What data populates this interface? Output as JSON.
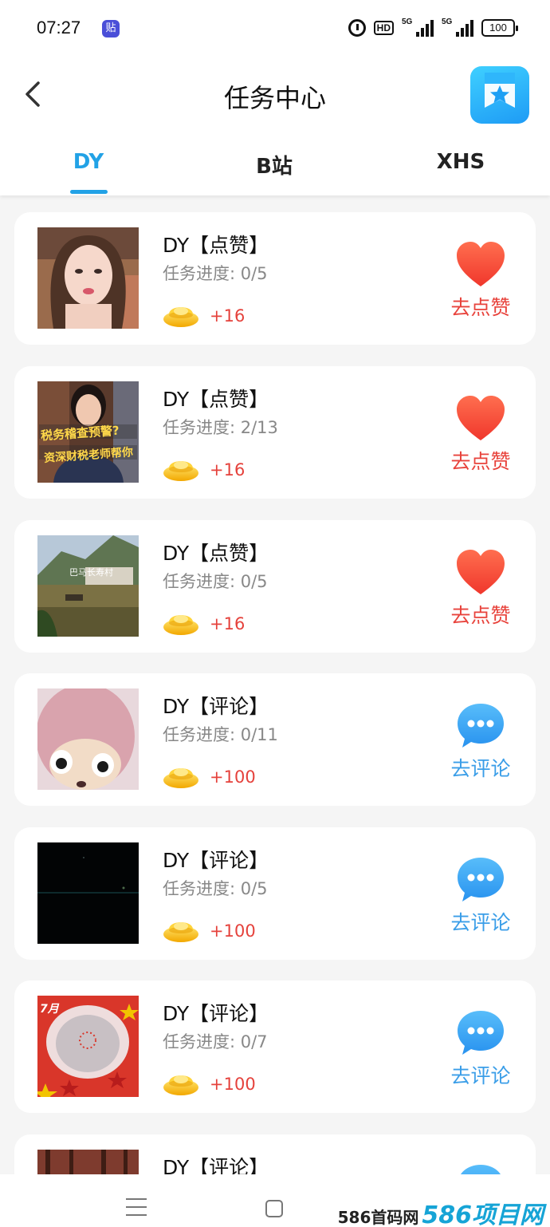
{
  "status_bar": {
    "time": "07:27",
    "app_badge": "贴",
    "hd_label": "HD",
    "signal_1_label": "5G",
    "signal_2_label": "5G",
    "battery": "100"
  },
  "header": {
    "title": "任务中心",
    "tabs": [
      {
        "label": "DY",
        "active": true
      },
      {
        "label": "B站",
        "active": false
      },
      {
        "label": "XHS",
        "active": false
      }
    ],
    "accent_color": "#22a2e6"
  },
  "tasks": [
    {
      "title": "DY【点赞】",
      "progress": "任务进度: 0/5",
      "reward": "+16",
      "action": "去点赞",
      "type": "like"
    },
    {
      "title": "DY【点赞】",
      "progress": "任务进度: 2/13",
      "reward": "+16",
      "action": "去点赞",
      "type": "like",
      "thumb_text_1": "税务稽查预警?",
      "thumb_text_2": "资深财税老师帮你"
    },
    {
      "title": "DY【点赞】",
      "progress": "任务进度: 0/5",
      "reward": "+16",
      "action": "去点赞",
      "type": "like",
      "thumb_text_1": "巴马长寿村"
    },
    {
      "title": "DY【评论】",
      "progress": "任务进度: 0/11",
      "reward": "+100",
      "action": "去评论",
      "type": "comment"
    },
    {
      "title": "DY【评论】",
      "progress": "任务进度: 0/5",
      "reward": "+100",
      "action": "去评论",
      "type": "comment"
    },
    {
      "title": "DY【评论】",
      "progress": "任务进度: 0/7",
      "reward": "+100",
      "action": "去评论",
      "type": "comment",
      "thumb_text_1": "7月"
    },
    {
      "title": "DY【评论】",
      "type": "comment"
    }
  ],
  "watermark": {
    "text": "586首码网",
    "big": "586项目网"
  },
  "colors": {
    "like": "#e8433c",
    "comment": "#3b9ee8",
    "reward": "#e5423c"
  }
}
